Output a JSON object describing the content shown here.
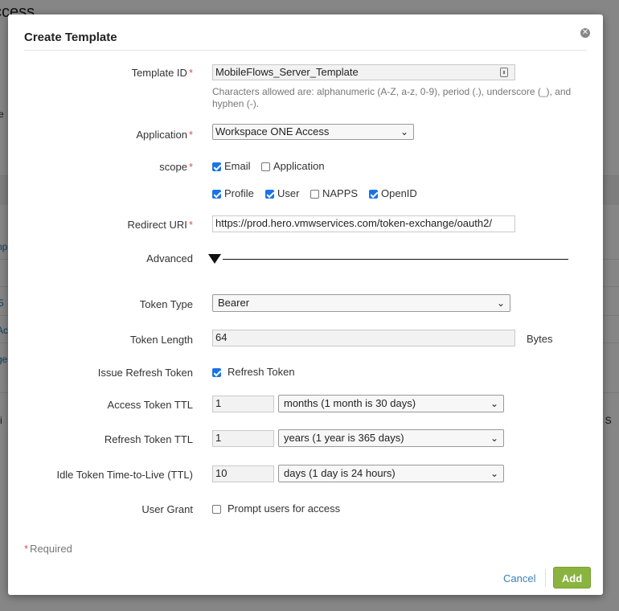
{
  "background": {
    "title_fragment": "ccess",
    "fragments": [
      "e",
      "np",
      "5",
      "Ac",
      "ge",
      "ri",
      "ed S"
    ]
  },
  "modal": {
    "title": "Create Template",
    "close_icon": "close-icon",
    "required_marker": "*",
    "template_id": {
      "label": "Template ID",
      "value": "MobileFlows_Server_Template",
      "help": "Characters allowed are: alphanumeric (A-Z, a-z, 0-9), period (.), underscore (_), and hyphen (-)."
    },
    "application": {
      "label": "Application",
      "selected": "Workspace ONE Access"
    },
    "scope": {
      "label": "scope",
      "options": [
        {
          "label": "Email",
          "checked": true
        },
        {
          "label": "Application",
          "checked": false
        },
        {
          "label": "Profile",
          "checked": true
        },
        {
          "label": "User",
          "checked": true
        },
        {
          "label": "NAPPS",
          "checked": false
        },
        {
          "label": "OpenID",
          "checked": true
        }
      ]
    },
    "redirect_uri": {
      "label": "Redirect URI",
      "value": "https://prod.hero.vmwservices.com/token-exchange/oauth2/"
    },
    "advanced": {
      "label": "Advanced"
    },
    "token_type": {
      "label": "Token Type",
      "selected": "Bearer"
    },
    "token_length": {
      "label": "Token Length",
      "value": "64",
      "units": "Bytes"
    },
    "issue_refresh_token": {
      "label": "Issue Refresh Token",
      "option": "Refresh Token",
      "checked": true
    },
    "access_token_ttl": {
      "label": "Access Token TTL",
      "value": "1",
      "unit": "months (1 month is 30 days)"
    },
    "refresh_token_ttl": {
      "label": "Refresh Token TTL",
      "value": "1",
      "unit": "years (1 year is 365 days)"
    },
    "idle_token_ttl": {
      "label": "Idle Token Time-to-Live (TTL)",
      "value": "10",
      "unit": "days (1 day is 24 hours)"
    },
    "user_grant": {
      "label": "User Grant",
      "option": "Prompt users for access",
      "checked": false
    },
    "footer": {
      "required_note": "Required",
      "cancel_label": "Cancel",
      "add_label": "Add"
    }
  },
  "colors": {
    "accent_checkbox": "#1a73e8",
    "add_button": "#8ab43f",
    "required": "#d9534f",
    "link": "#3a7fb8"
  }
}
